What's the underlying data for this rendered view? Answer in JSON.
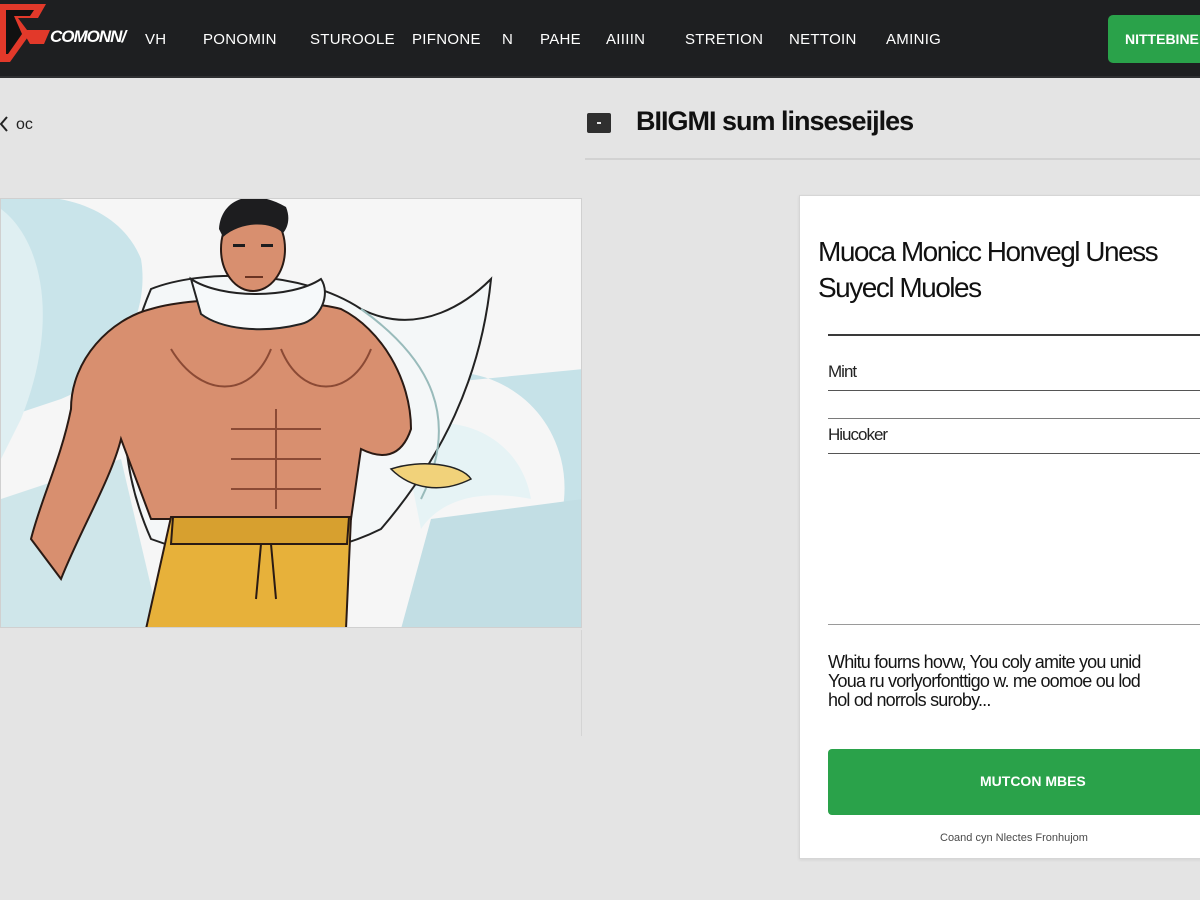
{
  "colors": {
    "topbar": "#1e1f21",
    "accent_green": "#2aa24a",
    "logo_red": "#e2392a",
    "page_bg": "#e4e4e4"
  },
  "header": {
    "logo_text": "COMONN/",
    "logo_icon": "brand-logo-icon",
    "nav": [
      "VH",
      "PONOMIN",
      "STUROOLE",
      "PIFNONE",
      "N",
      "PAHE",
      "AIIIIN",
      "STRETION",
      "NETTOIN",
      "AMINIG"
    ],
    "cta_label": "NITTEBINE"
  },
  "back": {
    "icon": "chevron-left-icon",
    "label": "oc"
  },
  "main": {
    "panel_icon": "panel-icon",
    "title": "BIIGMI sum linseseijles"
  },
  "card": {
    "title_line1": "Muoca Monicc Honvegl Uness",
    "title_line2": "Suyecl Muoles",
    "fields": [
      {
        "label": "Mint"
      },
      {
        "label": "Hiucoker"
      }
    ],
    "body_line1": "Whitu fourns hovw, You coly amite you unid",
    "body_line2": "Youa ru vorlyorfonttigo w. me oomoe ou lod",
    "body_line3": "hol od norrols suroby...",
    "submit_label": "MUTCON MBES",
    "footnote": "Coand cyn Nlectes Fronhujom"
  }
}
